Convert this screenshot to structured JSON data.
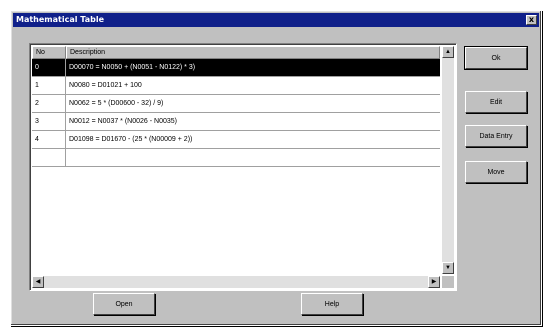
{
  "window": {
    "title": "Mathematical Table",
    "close_glyph": "x"
  },
  "table": {
    "columns": [
      "No",
      "Description"
    ],
    "rows": [
      {
        "no": "0",
        "desc": "D00070 = N0050 + (N0051 - N0122) * 3)"
      },
      {
        "no": "1",
        "desc": "N0080 = D01021 + 100"
      },
      {
        "no": "2",
        "desc": "N0062 = 5 * (D00600 - 32) / 9)"
      },
      {
        "no": "3",
        "desc": "N0012 = N0037 * (N0026 - N0035)"
      },
      {
        "no": "4",
        "desc": "D01098 = D01670 - (25 * (N00009 + 2))"
      },
      {
        "no": "",
        "desc": ""
      }
    ],
    "selected_row": 0
  },
  "side_buttons": {
    "ok": "Ok",
    "edit": "Edit",
    "data_entry": "Data Entry",
    "move": "Move"
  },
  "bottom_buttons": {
    "open": "Open",
    "help": "Help"
  }
}
